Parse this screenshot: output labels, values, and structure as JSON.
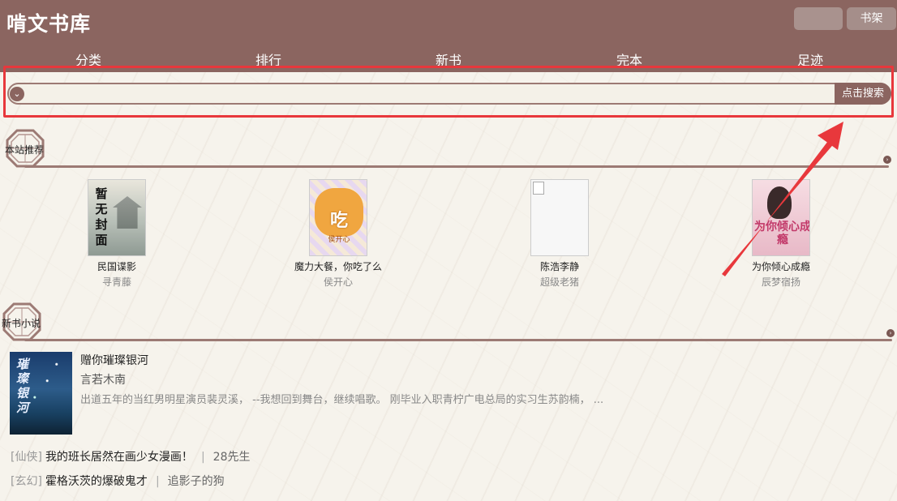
{
  "header": {
    "site_title": "啃文书库",
    "shelf_label": "书架"
  },
  "nav": {
    "items": [
      "分类",
      "排行",
      "新书",
      "完本",
      "足迹"
    ]
  },
  "search": {
    "toggle_glyph": "⌄",
    "button_label": "点击搜索",
    "value": "",
    "placeholder": ""
  },
  "recommend": {
    "section_label": "本站推荐",
    "books": [
      {
        "title": "民国谍影",
        "author": "寻青藤",
        "cover_text": "暂无封面"
      },
      {
        "title": "魔力大餐，你吃了么",
        "author": "侯开心",
        "cover_text": "吃",
        "cover_author": "侯开心"
      },
      {
        "title": "陈浩李静",
        "author": "超级老猪"
      },
      {
        "title": "为你倾心成瘾",
        "author": "辰梦宿扬",
        "cover_text": "为你倾心成瘾"
      }
    ]
  },
  "new_books": {
    "section_label": "新书小说",
    "featured": {
      "title": "赠你璀璨银河",
      "author": "言若木南",
      "description": "出道五年的当红男明星演员裴灵溪， --我想回到舞台，继续唱歌。 刚毕业入职青柠广电总局的实习生苏韵楠， ...",
      "cover_text": "璀璨银河"
    },
    "list": [
      {
        "genre": "[仙侠]",
        "title": "我的班长居然在画少女漫画！",
        "author": "28先生"
      },
      {
        "genre": "[玄幻]",
        "title": "霍格沃茨的爆破鬼才",
        "author": "追影子的狗"
      }
    ]
  },
  "colors": {
    "header_bg": "#8b6560",
    "highlight_box": "#e8383c",
    "page_bg": "#f6f3ec"
  }
}
